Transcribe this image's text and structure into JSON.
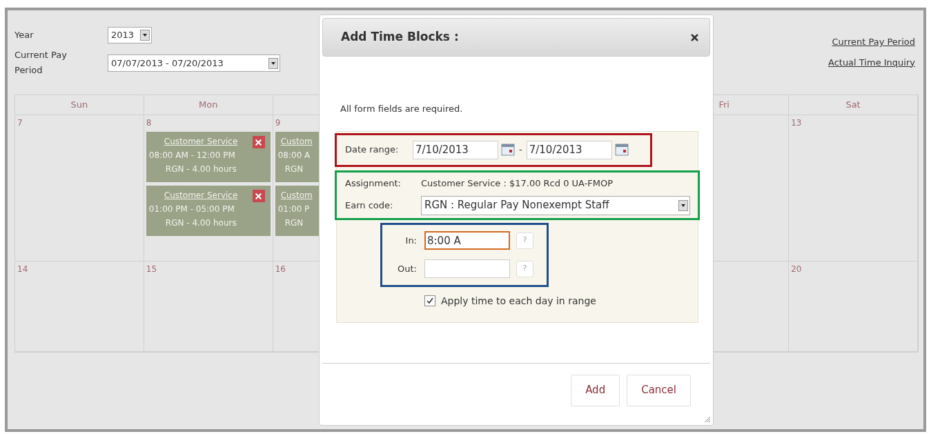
{
  "filters": {
    "year_label": "Year",
    "year_value": "2013",
    "period_label": "Current Pay Period",
    "period_value": "07/07/2013 - 07/20/2013"
  },
  "links": [
    "Current Pay Period",
    "Actual Time Inquiry"
  ],
  "calendar": {
    "headers_left": [
      "Sun",
      "Mon"
    ],
    "headers_right": [
      "Fri",
      "Sat"
    ],
    "weeks": [
      {
        "cells": [
          {
            "date": "7"
          },
          {
            "date": "8",
            "blocks": [
              {
                "title": "Customer Service",
                "time": "08:00 AM - 12:00 PM",
                "detail": "RGN - 4.00 hours",
                "deletable": true
              },
              {
                "title": "Customer Service",
                "time": "01:00 PM - 05:00 PM",
                "detail": "RGN - 4.00 hours",
                "deletable": true
              }
            ]
          },
          {
            "date": "9",
            "blocks": [
              {
                "title": "Custom",
                "time": "08:00 A",
                "detail": "RGN",
                "deletable": false
              },
              {
                "title": "Custom",
                "time": "01:00 P",
                "detail": "RGN",
                "deletable": false
              }
            ]
          },
          {},
          {},
          {},
          {
            "date": "13"
          }
        ]
      },
      {
        "cells": [
          {
            "date": "14"
          },
          {
            "date": "15"
          },
          {
            "date": "16"
          },
          {},
          {},
          {},
          {
            "date": "20"
          }
        ]
      }
    ]
  },
  "dialog": {
    "title": "Add Time Blocks :",
    "note": "All form fields are required.",
    "date_range": {
      "label": "Date range:",
      "from": "7/10/2013",
      "to": "7/10/2013",
      "separator": "-"
    },
    "assignment": {
      "label": "Assignment:",
      "value": "Customer Service : $17.00 Rcd 0 UA-FMOP"
    },
    "earn_code": {
      "label": "Earn code:",
      "value": "RGN : Regular Pay Nonexempt Staff"
    },
    "times": [
      {
        "label": "In:",
        "value": "8:00 A",
        "focused": true,
        "help": "?"
      },
      {
        "label": "Out:",
        "focused": false,
        "help": "?"
      }
    ],
    "apply_each_day": {
      "label": "Apply time to each day in range",
      "checked": true
    },
    "buttons": [
      "Add",
      "Cancel"
    ]
  }
}
